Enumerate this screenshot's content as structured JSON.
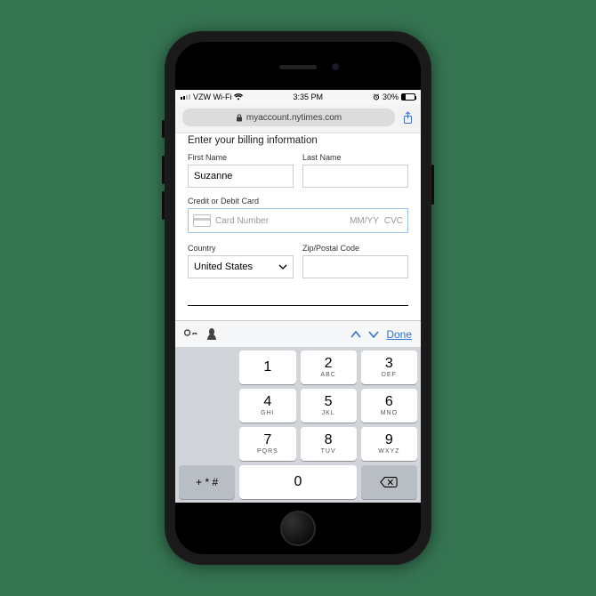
{
  "statusbar": {
    "carrier": "VZW Wi-Fi",
    "time": "3:35 PM",
    "battery_pct": "30%"
  },
  "urlbar": {
    "domain": "myaccount.nytimes.com"
  },
  "form": {
    "heading": "Enter your billing information",
    "first_name_label": "First Name",
    "first_name_value": "Suzanne",
    "last_name_label": "Last Name",
    "last_name_value": "",
    "card_label": "Credit or Debit Card",
    "card_placeholder": "Card Number",
    "card_exp_placeholder": "MM/YY",
    "card_cvc_placeholder": "CVC",
    "country_label": "Country",
    "country_value": "United States",
    "zip_label": "Zip/Postal Code",
    "zip_value": ""
  },
  "accessory": {
    "done_label": "Done"
  },
  "keypad": {
    "keys": [
      {
        "num": "1",
        "sub": ""
      },
      {
        "num": "2",
        "sub": "ABC"
      },
      {
        "num": "3",
        "sub": "DEF"
      },
      {
        "num": "4",
        "sub": "GHI"
      },
      {
        "num": "5",
        "sub": "JKL"
      },
      {
        "num": "6",
        "sub": "MNO"
      },
      {
        "num": "7",
        "sub": "PQRS"
      },
      {
        "num": "8",
        "sub": "TUV"
      },
      {
        "num": "9",
        "sub": "WXYZ"
      },
      {
        "num": "0",
        "sub": ""
      }
    ],
    "symbols_key": "+ * #"
  }
}
